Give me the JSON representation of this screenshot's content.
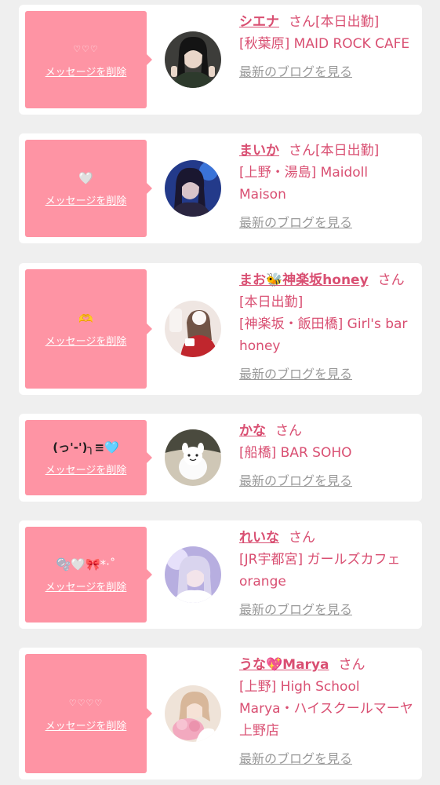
{
  "delete_label": "メッセージを削除",
  "san_label": "さん",
  "blog_label": "最新のブログを見る",
  "colors": {
    "background": "#efefef",
    "card": "#ffffff",
    "bubble": "#fe94a4",
    "accent": "#d94f72",
    "link_gray": "#999999"
  },
  "cards": [
    {
      "message": "♡♡♡",
      "name": "シエナ",
      "status": "[本日出勤]",
      "shop": "[秋葉原] MAID ROCK CAFE",
      "avatar_icon": "avatar-photo-icon"
    },
    {
      "message": "🤍",
      "name": "まいか",
      "status": "[本日出勤]",
      "shop": "[上野・湯島] Maidoll Maison",
      "avatar_icon": "avatar-photo-icon"
    },
    {
      "message": "🫶",
      "name": "まお🐝神楽坂honey",
      "status": "[本日出勤]",
      "shop": "[神楽坂・飯田橋] Girl's bar honey",
      "avatar_icon": "avatar-photo-icon"
    },
    {
      "message": "(っ'-')╮≡🩵",
      "name": "かな",
      "status": "",
      "shop": "[船橋] BAR SOHO",
      "avatar_icon": "avatar-photo-icon"
    },
    {
      "message": "🫧🤍🎀*·˚",
      "name": "れいな",
      "status": "",
      "shop": "[JR宇都宮] ガールズカフェ orange",
      "avatar_icon": "avatar-photo-icon"
    },
    {
      "message": "♡♡♡♡",
      "name": "うな💖Marya",
      "status": "",
      "shop": "[上野] High School Marya・ハイスクールマーヤ上野店",
      "avatar_icon": "avatar-photo-icon"
    }
  ]
}
